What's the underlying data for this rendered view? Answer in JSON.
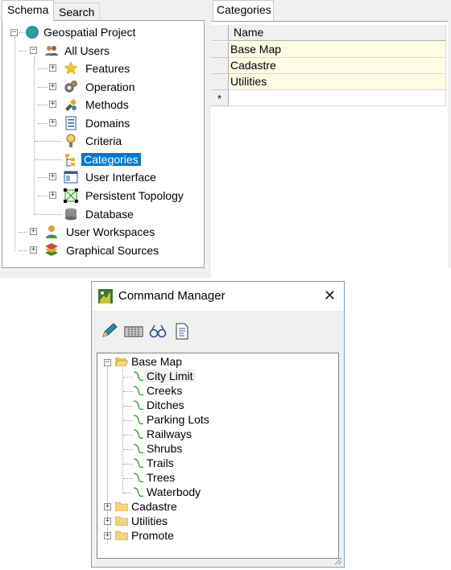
{
  "schema_panel": {
    "tabs": {
      "schema": "Schema",
      "search": "Search"
    },
    "tree": {
      "root": "Geospatial Project",
      "all_users": "All Users",
      "items": [
        "Features",
        "Operation",
        "Methods",
        "Domains",
        "Criteria",
        "Categories",
        "User Interface",
        "Persistent Topology",
        "Database"
      ],
      "user_workspaces": "User Workspaces",
      "graphical_sources": "Graphical Sources",
      "selected": "Categories"
    }
  },
  "categories_panel": {
    "tab": "Categories",
    "column_header": "Name",
    "rows": [
      "Base Map",
      "Cadastre",
      "Utilities"
    ],
    "new_row_marker": "*"
  },
  "command_manager": {
    "title": "Command Manager",
    "close_glyph": "✕",
    "toolbar": [
      "pencil-icon",
      "keyboard-icon",
      "binoculars-icon",
      "document-icon"
    ],
    "tree": {
      "base_map": "Base Map",
      "base_map_children": [
        "City Limit",
        "Creeks",
        "Ditches",
        "Parking Lots",
        "Railways",
        "Shrubs",
        "Trails",
        "Trees",
        "Waterbody"
      ],
      "other_folders": [
        "Cadastre",
        "Utilities",
        "Promote"
      ]
    }
  },
  "colors": {
    "selection": "#0078d7",
    "grid_data_bg": "#fffce6",
    "dialog_border": "#6fa5c9"
  }
}
